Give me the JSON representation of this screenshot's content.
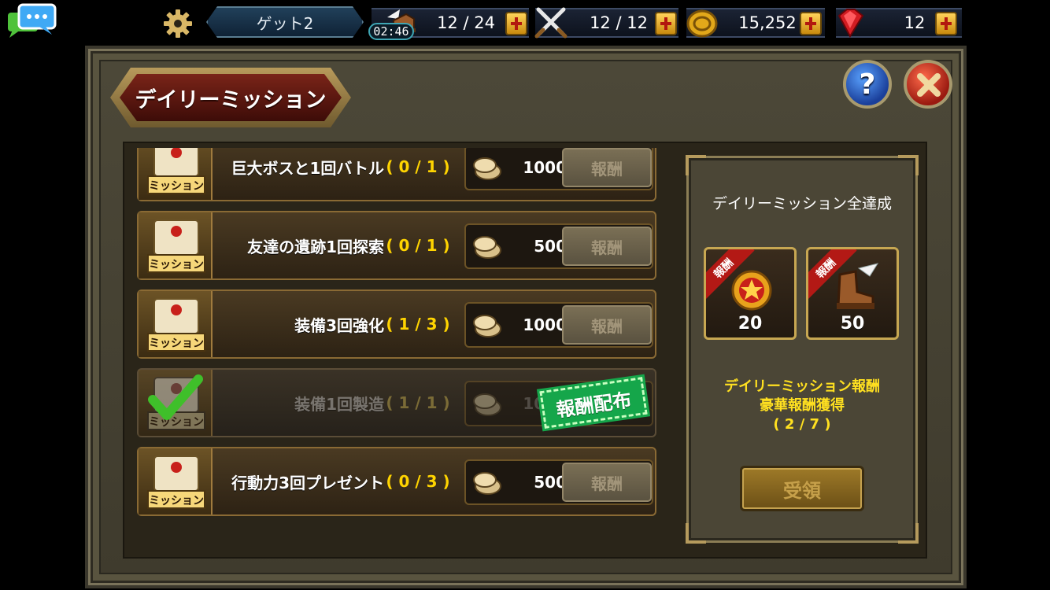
{
  "topbar": {
    "title": "ゲット2",
    "timer": "02:46",
    "stamina": "12 / 24",
    "battle": "12 / 12",
    "gold": "15,252",
    "gems": "12"
  },
  "header": {
    "title": "デイリーミッション",
    "help_label": "?"
  },
  "missions": [
    {
      "name": "巨大ボスと1回バトル",
      "progress": "( 0 / 1 )",
      "reward": "1000",
      "button": "報酬"
    },
    {
      "name": "友達の遺跡1回探索",
      "progress": "( 0 / 1 )",
      "reward": "500",
      "button": "報酬"
    },
    {
      "name": "装備3回強化",
      "progress": "( 1 / 3 )",
      "reward": "1000",
      "button": "報酬"
    },
    {
      "name": "装備1回製造",
      "progress": "( 1 / 1 )",
      "reward": "1000",
      "button": "報酬",
      "stamp": "報酬配布",
      "completed": true
    },
    {
      "name": "行動力3回プレゼント",
      "progress": "( 0 / 3 )",
      "reward": "500",
      "button": "報酬"
    }
  ],
  "mission_icon_label": "ミッション",
  "side": {
    "title": "デイリーミッション全達成",
    "rewards": [
      {
        "ribbon": "報酬",
        "count": "20",
        "icon": "medal-icon"
      },
      {
        "ribbon": "報酬",
        "count": "50",
        "icon": "winged-boot-icon"
      }
    ],
    "message_line1": "デイリーミッション報酬",
    "message_line2": "豪華報酬獲得",
    "message_line3": "( 2 / 7 )",
    "receive_button": "受領"
  },
  "colors": {
    "accent_yellow": "#ffd400",
    "stamp_green": "#15a64a",
    "ribbon_red": "#b31915"
  }
}
